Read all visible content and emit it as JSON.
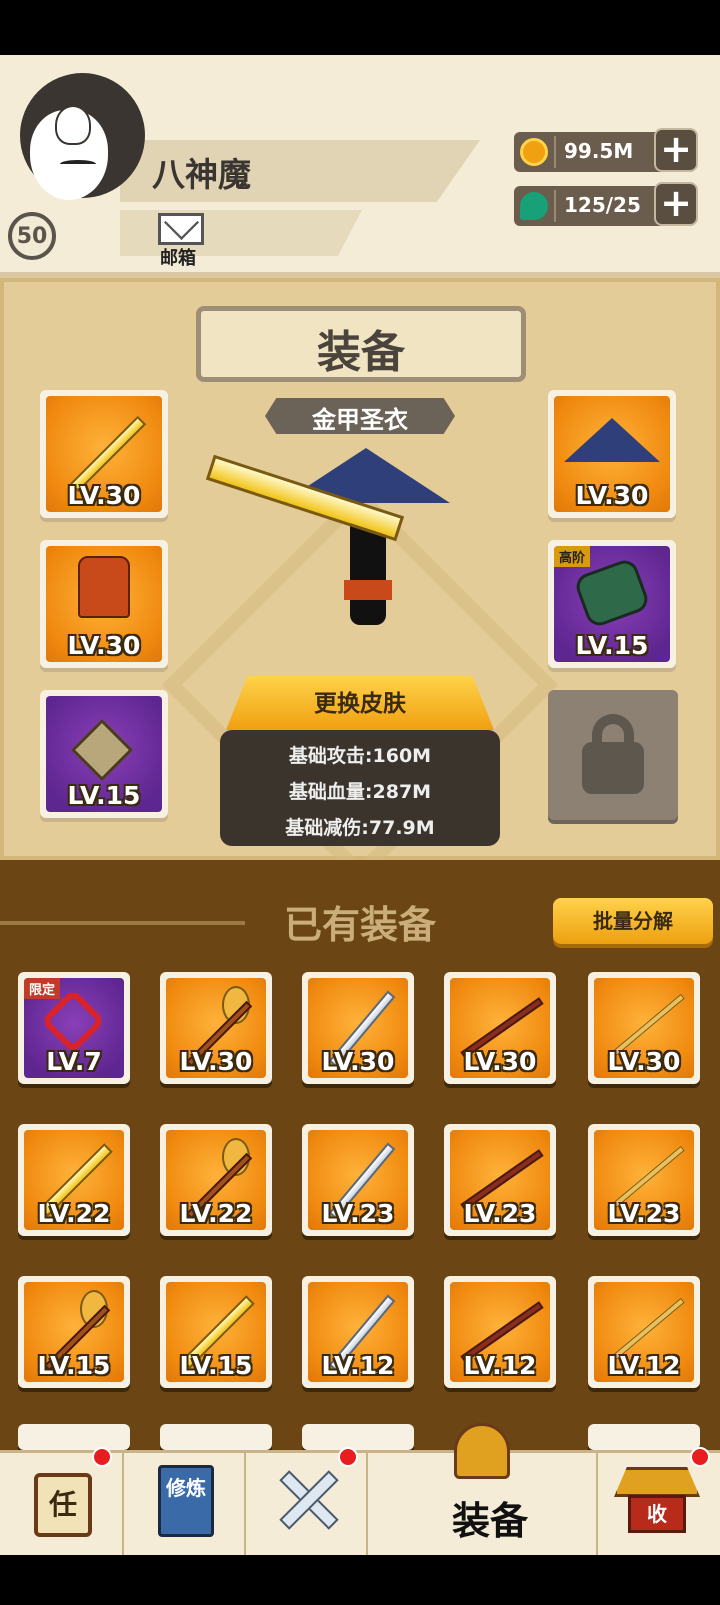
{
  "player": {
    "name": "八神魔",
    "level": "50",
    "mail_label": "邮箱"
  },
  "resources": [
    {
      "icon": "gold-coin-icon",
      "value": "99.5M",
      "color": "#f0a010"
    },
    {
      "icon": "jade-gem-icon",
      "value": "125/25",
      "color": "#18a078"
    }
  ],
  "equipment": {
    "title": "装备",
    "skin_name": "金甲圣衣",
    "change_skin_label": "更换皮肤",
    "slots_left": [
      {
        "icon": "golden-broadsword-icon",
        "level": "LV.30",
        "rarity": "orange"
      },
      {
        "icon": "armor-icon",
        "level": "LV.30",
        "rarity": "orange"
      },
      {
        "icon": "amulet-icon",
        "level": "LV.15",
        "rarity": "purple"
      }
    ],
    "slots_right": [
      {
        "icon": "straw-hat-icon",
        "level": "LV.30",
        "rarity": "orange"
      },
      {
        "icon": "bracer-icon",
        "level": "LV.15",
        "rarity": "purple",
        "tag": "高阶"
      }
    ],
    "stats": [
      "基础攻击:160M",
      "基础血量:287M",
      "基础减伤:77.9M"
    ]
  },
  "inventory": {
    "title": "已有装备",
    "bulk_button": "批量分解",
    "items": [
      {
        "icon": "lucky-knot-icon",
        "level": "LV.7",
        "rarity": "purple",
        "tag": "限定"
      },
      {
        "icon": "mace-icon",
        "level": "LV.30",
        "rarity": "orange"
      },
      {
        "icon": "silver-sword-icon",
        "level": "LV.30",
        "rarity": "orange"
      },
      {
        "icon": "staff-icon",
        "level": "LV.30",
        "rarity": "orange"
      },
      {
        "icon": "spear-icon",
        "level": "LV.30",
        "rarity": "orange"
      },
      {
        "icon": "golden-broadsword-icon",
        "level": "LV.22",
        "rarity": "orange"
      },
      {
        "icon": "mace-icon",
        "level": "LV.22",
        "rarity": "orange"
      },
      {
        "icon": "silver-sword-icon",
        "level": "LV.23",
        "rarity": "orange"
      },
      {
        "icon": "staff-icon",
        "level": "LV.23",
        "rarity": "orange"
      },
      {
        "icon": "spear-icon",
        "level": "LV.23",
        "rarity": "orange"
      },
      {
        "icon": "mace-icon",
        "level": "LV.15",
        "rarity": "orange"
      },
      {
        "icon": "golden-broadsword-icon",
        "level": "LV.15",
        "rarity": "orange"
      },
      {
        "icon": "silver-sword-icon",
        "level": "LV.12",
        "rarity": "orange"
      },
      {
        "icon": "staff-icon",
        "level": "LV.12",
        "rarity": "orange"
      },
      {
        "icon": "spear-icon",
        "level": "LV.12",
        "rarity": "orange"
      }
    ]
  },
  "nav": {
    "task_glyph": "任",
    "cultivate_glyph": "修炼",
    "equip_label": "装备",
    "collect_glyph": "收"
  }
}
